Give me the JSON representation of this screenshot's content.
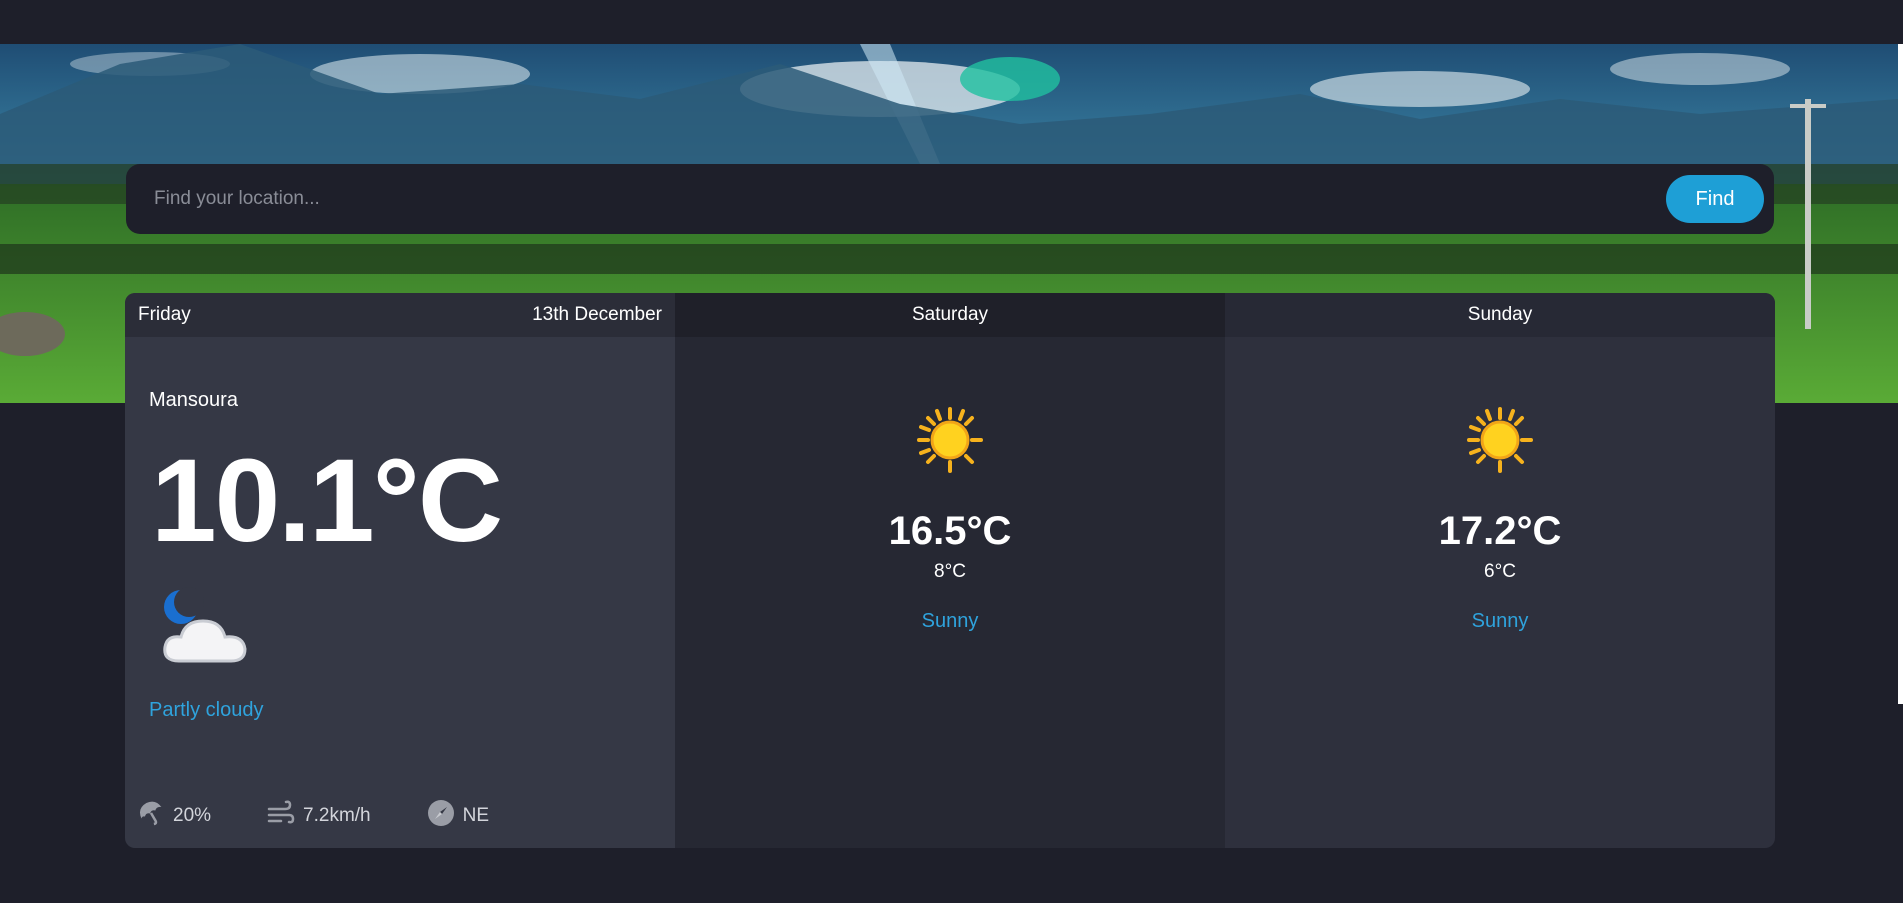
{
  "search": {
    "placeholder": "Find your location...",
    "button_label": "Find"
  },
  "today": {
    "day": "Friday",
    "date": "13th December",
    "location": "Mansoura",
    "temperature": "10.1°C",
    "condition": "Partly cloudy",
    "condition_icon": "moon-cloud-icon",
    "rain_chance": "20%",
    "wind_speed": "7.2km/h",
    "wind_direction": "NE"
  },
  "forecast": [
    {
      "day": "Saturday",
      "max_temp": "16.5°C",
      "min_temp": "8°C",
      "condition": "Sunny",
      "icon": "sun-icon"
    },
    {
      "day": "Sunday",
      "max_temp": "17.2°C",
      "min_temp": "6°C",
      "condition": "Sunny",
      "icon": "sun-icon"
    }
  ],
  "colors": {
    "background": "#1e1f2a",
    "accent": "#1e9fd6",
    "condition_text": "#2fa3dd"
  }
}
